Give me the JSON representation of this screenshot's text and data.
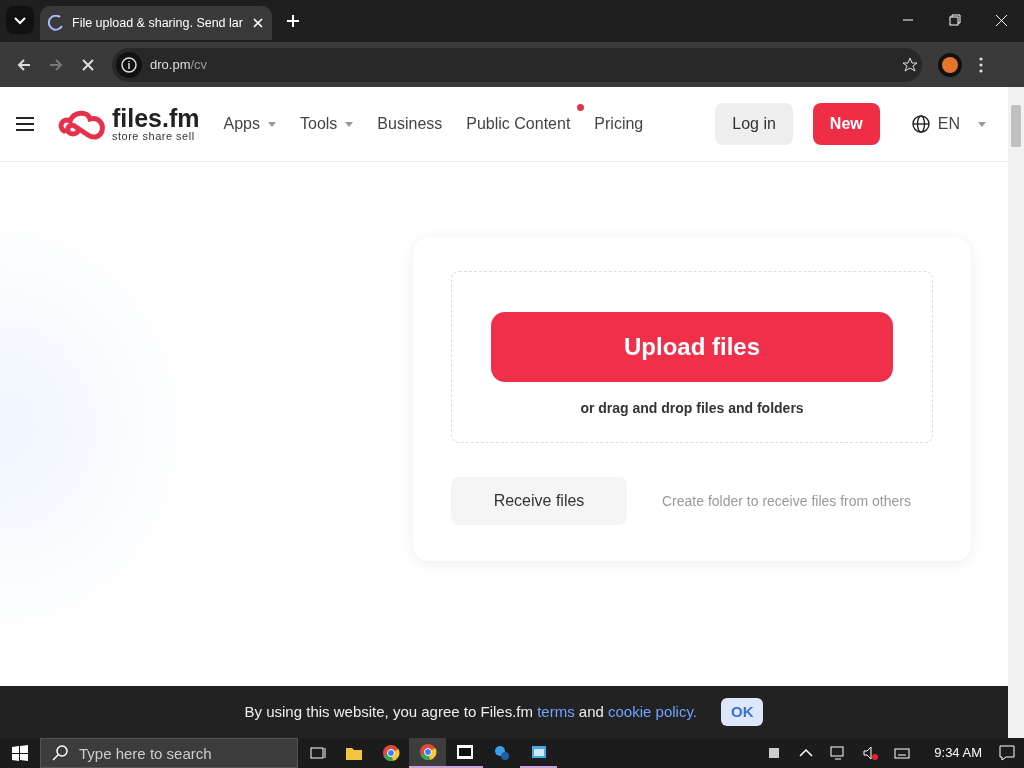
{
  "browser": {
    "tab": {
      "title": "File upload & sharing. Send lar",
      "loading": true
    },
    "address": {
      "host": "dro.pm",
      "path": "/cv"
    }
  },
  "nav": {
    "logo": {
      "name": "files.fm",
      "tagline": "store share sell"
    },
    "items": [
      {
        "label": "Apps",
        "dropdown": true,
        "dot": false
      },
      {
        "label": "Tools",
        "dropdown": true,
        "dot": false
      },
      {
        "label": "Business",
        "dropdown": false,
        "dot": false
      },
      {
        "label": "Public Content",
        "dropdown": false,
        "dot": true
      },
      {
        "label": "Pricing",
        "dropdown": false,
        "dot": false
      }
    ],
    "login": "Log in",
    "new": "New",
    "language": "EN"
  },
  "upload": {
    "button": "Upload files",
    "hint": "or drag and drop files and folders",
    "receive_button": "Receive files",
    "receive_hint": "Create folder to receive files from others"
  },
  "cookie": {
    "text": "By using this website, you agree to Files.fm ",
    "terms": "terms",
    "and": " and ",
    "policy": "cookie policy.",
    "ok": "OK"
  },
  "taskbar": {
    "search_placeholder": "Type here to search",
    "time": "9:34 AM",
    "apps": [
      {
        "kind": "taskview",
        "selected": false,
        "running": false
      },
      {
        "kind": "folder",
        "selected": false,
        "running": false
      },
      {
        "kind": "chrome",
        "selected": false,
        "running": false
      },
      {
        "kind": "chrome",
        "selected": true,
        "running": true
      },
      {
        "kind": "archive",
        "selected": false,
        "running": true
      },
      {
        "kind": "app",
        "selected": false,
        "running": false
      },
      {
        "kind": "window",
        "selected": false,
        "running": true
      }
    ]
  }
}
